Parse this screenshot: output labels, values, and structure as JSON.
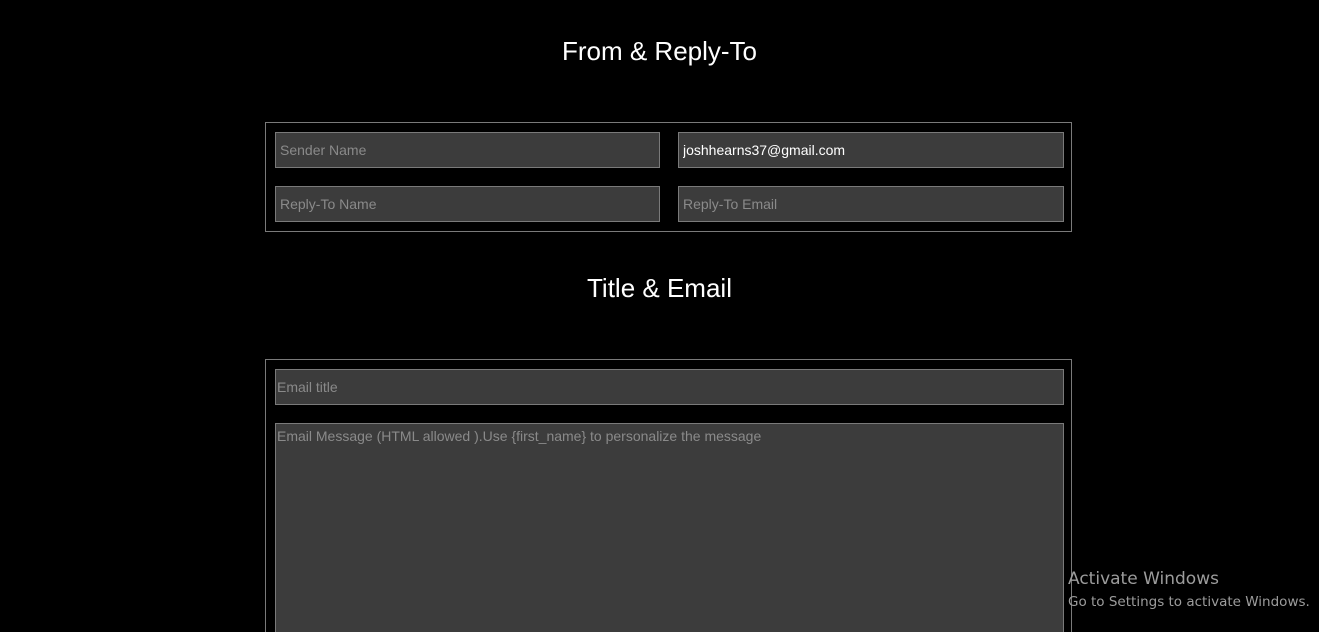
{
  "sections": {
    "from_reply_to": {
      "title": "From & Reply-To",
      "sender_name": {
        "value": "",
        "placeholder": "Sender Name"
      },
      "sender_email": {
        "value": "joshhearns37@gmail.com",
        "placeholder": ""
      },
      "reply_to_name": {
        "value": "",
        "placeholder": "Reply-To Name"
      },
      "reply_to_email": {
        "value": "",
        "placeholder": "Reply-To Email"
      }
    },
    "title_email": {
      "title": "Title & Email",
      "email_title": {
        "value": "",
        "placeholder": "Email title"
      },
      "email_message": {
        "value": "",
        "placeholder": "Email Message (HTML allowed ).Use {first_name} to personalize the message"
      }
    }
  },
  "watermark": {
    "title": "Activate Windows",
    "subtitle": "Go to Settings to activate Windows."
  },
  "colors": {
    "background": "#000000",
    "field_background": "#3c3c3c",
    "border": "#7a7a7a",
    "placeholder": "#8a8a8a",
    "text": "#ffffff"
  }
}
